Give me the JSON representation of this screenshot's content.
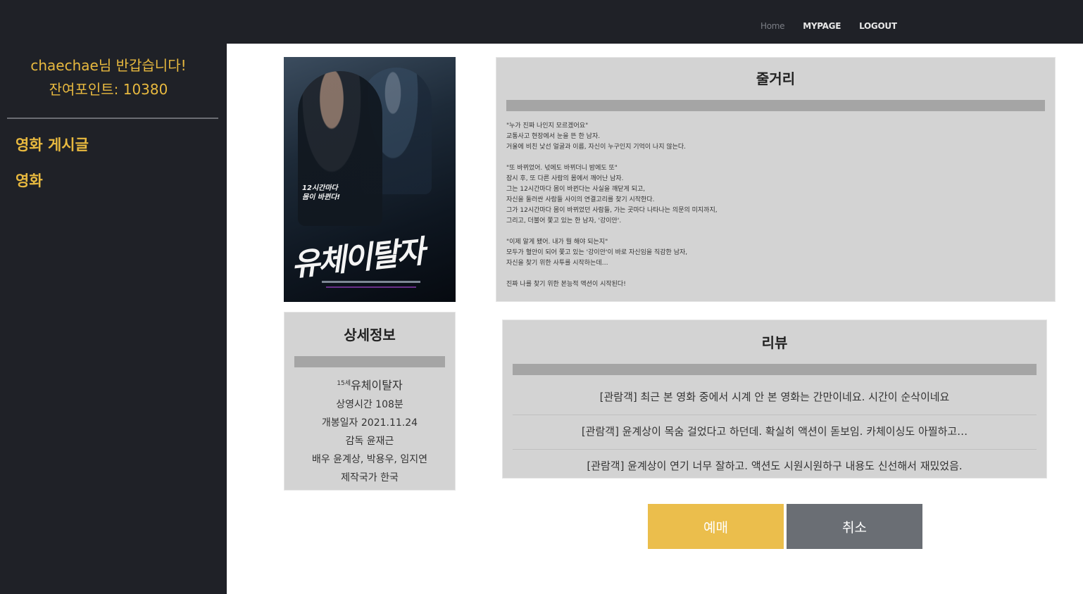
{
  "topnav": {
    "home": "Home",
    "mypage": "MYPAGE",
    "logout": "LOGOUT"
  },
  "sidebar": {
    "greeting": "chaechae님 반갑습니다!",
    "points": "잔여포인트: 10380",
    "items": [
      {
        "label": "영화 게시글"
      },
      {
        "label": "영화"
      }
    ]
  },
  "poster": {
    "tagline": "12시간마다\n몸이 바뀐다!",
    "title_art": "유체이탈자"
  },
  "details": {
    "title": "상세정보",
    "rating": "15세",
    "movie_name": "유체이탈자",
    "runtime": "상영시간 108분",
    "release": "개봉일자 2021.11.24",
    "director": "감독 윤재근",
    "cast": "배우 윤계상, 박용우, 임지연",
    "country": "제작국가 한국"
  },
  "synopsis": {
    "title": "줄거리",
    "text": "\"누가 진짜 나인지 모르겠어요\"\n교통사고 현장에서 눈을 뜬 한 남자.\n거울에 비친 낯선 얼굴과 이름, 자신이 누구인지 기억이 나지 않는다.\n\n\"또 바뀌었어. 넋에도 바뀌더니 밤에도 또\"\n잠시 후, 또 다른 사람의 몸에서 깨어난 남자.\n그는 12시간마다 몸이 바뀐다는 사실을 깨닫게 되고,\n자신을 둘러싼 사람들 사이의 연결고리를 찾기 시작한다.\n그가 12시간마다 몸이 바뀌었던 사람들, 가는 곳마다 나타나는 의문의 미지까지,\n그리고, 더불어 쫓고 있는 한 남자, '강이안'.\n\n\"이제 알게 됐어. 내가 뭘 해야 되는지\"\n모두가 혈안이 되어 쫓고 있는 '강이안'이 바로 자신임을 직감한 남자,\n자신을 찾기 위한 사투를 시작하는데…\n\n진짜 나를 찾기 위한 본능적 액션이 시작된다!"
  },
  "reviews": {
    "title": "리뷰",
    "items": [
      "[관람객] 최근 본 영화 중에서 시계 안 본 영화는 간만이네요. 시간이 순삭이네요",
      "[관람객] 윤계상이 목숨 걸었다고 하던데. 확실히 액션이 돋보임. 카체이싱도 아찔하고…",
      "[관람객] 윤계상이 연기 너무 잘하고. 액션도 시원시원하구 내용도 신선해서 재밌었음."
    ]
  },
  "buttons": {
    "book": "예매",
    "cancel": "취소"
  },
  "colors": {
    "accent": "#ebbe4c",
    "background_dark": "#1f2127",
    "panel": "#d3d3d3",
    "cancel": "#6a6e74"
  }
}
